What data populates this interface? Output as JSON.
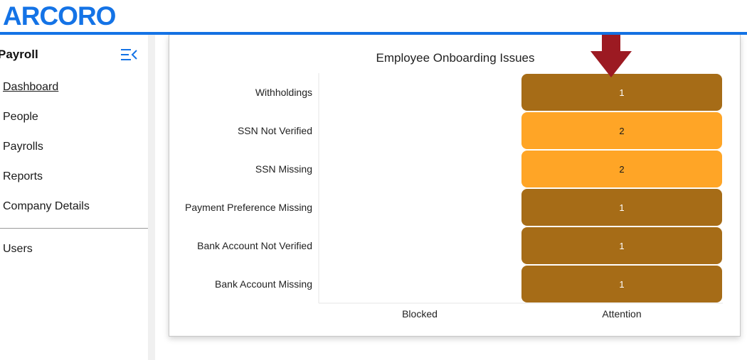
{
  "header": {
    "logo_text": "ARCORO",
    "accent_color": "#1473e6"
  },
  "sidebar": {
    "title": "Payroll",
    "collapse_icon": "menu-collapse-icon",
    "items": [
      {
        "label": "Dashboard",
        "active": true
      },
      {
        "label": "People",
        "active": false
      },
      {
        "label": "Payrolls",
        "active": false
      },
      {
        "label": "Reports",
        "active": false
      },
      {
        "label": "Company Details",
        "active": false
      }
    ],
    "secondary_items": [
      {
        "label": "Users",
        "active": false
      }
    ]
  },
  "chart_data": {
    "type": "heatmap",
    "title": "Employee Onboarding Issues",
    "x_categories": [
      "Blocked",
      "Attention"
    ],
    "y_categories": [
      "Withholdings",
      "SSN Not Verified",
      "SSN Missing",
      "Payment Preference Missing",
      "Bank Account Not Verified",
      "Bank Account Missing"
    ],
    "cells": [
      {
        "x": "Attention",
        "y": "Withholdings",
        "value": 1
      },
      {
        "x": "Attention",
        "y": "SSN Not Verified",
        "value": 2
      },
      {
        "x": "Attention",
        "y": "SSN Missing",
        "value": 2
      },
      {
        "x": "Attention",
        "y": "Payment Preference Missing",
        "value": 1
      },
      {
        "x": "Attention",
        "y": "Bank Account Not Verified",
        "value": 1
      },
      {
        "x": "Attention",
        "y": "Bank Account Missing",
        "value": 1
      }
    ],
    "colors": {
      "1": "#a66c17",
      "2": "#ffa526"
    },
    "label_colors": {
      "1": "#ffffff",
      "2": "#1a1a1a"
    },
    "annotation": {
      "type": "arrow-down",
      "target_x": "Attention",
      "target_y": "Withholdings",
      "color": "#9c1a22"
    }
  }
}
